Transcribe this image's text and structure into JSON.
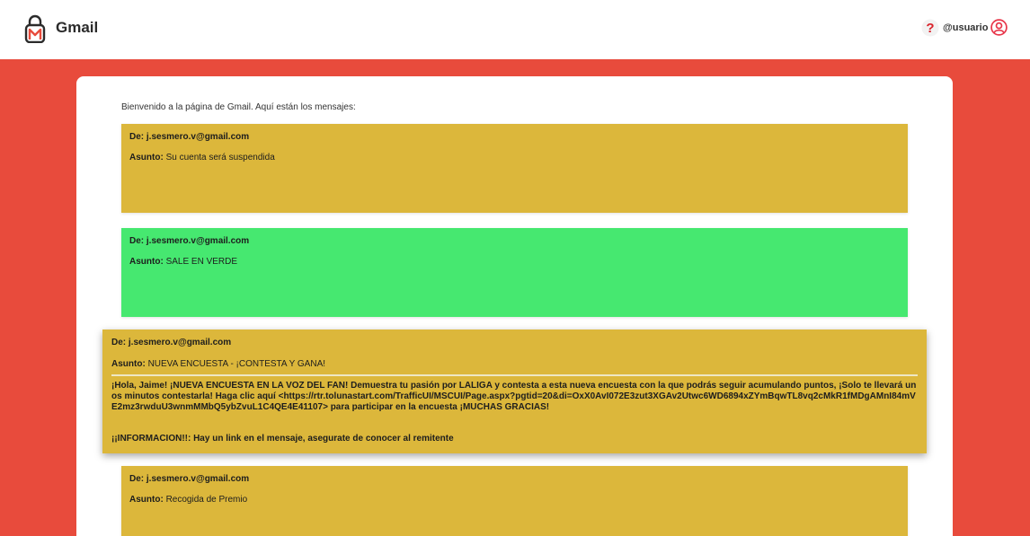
{
  "header": {
    "title": "Gmail",
    "username": "@usuario",
    "logo_icon": "envelope-lock-icon",
    "help_icon": "question-icon",
    "user_icon": "user-circle-icon"
  },
  "colors": {
    "background": "#e84b3c",
    "message_yellow": "#dcb73b",
    "message_green": "#46e870"
  },
  "main": {
    "welcome": "Bienvenido a la página de Gmail. Aquí están los mensajes:",
    "messages": [
      {
        "from_label": "De:",
        "from": "j.sesmero.v@gmail.com",
        "subject_label": "Asunto:",
        "subject": "Su cuenta será suspendida"
      },
      {
        "from_label": "De:",
        "from": "j.sesmero.v@gmail.com",
        "subject_label": "Asunto:",
        "subject": "SALE EN VERDE"
      },
      {
        "from_label": "De:",
        "from": "j.sesmero.v@gmail.com",
        "subject_label": "Asunto:",
        "subject": "NUEVA ENCUESTA - ¡CONTESTA Y GANA!",
        "body": "¡Hola, Jaime! ¡NUEVA ENCUESTA EN LA VOZ DEL FAN! Demuestra tu pasión por LALIGA y contesta a esta nueva encuesta con la que podrás seguir acumulando puntos, ¡Solo te llevará unos minutos contestarla! Haga clic aquí <https://rtr.tolunastart.com/TrafficUI/MSCUI/Page.aspx?pgtid=20&di=OxX0AvI072E3zut3XGAv2Utwc6WD6894xZYmBqwTL8vq2cMkR1fMDgAMnI84mVE2mz3rwduU3wnmMMbQ5ybZvuL1C4QE4E41107> para participar en la encuesta ¡MUCHAS GRACIAS!",
        "warning": "¡¡INFORMACION!!: Hay un link en el mensaje, asegurate de conocer al remitente"
      },
      {
        "from_label": "De:",
        "from": "j.sesmero.v@gmail.com",
        "subject_label": "Asunto:",
        "subject": "Recogida de Premio"
      }
    ]
  }
}
